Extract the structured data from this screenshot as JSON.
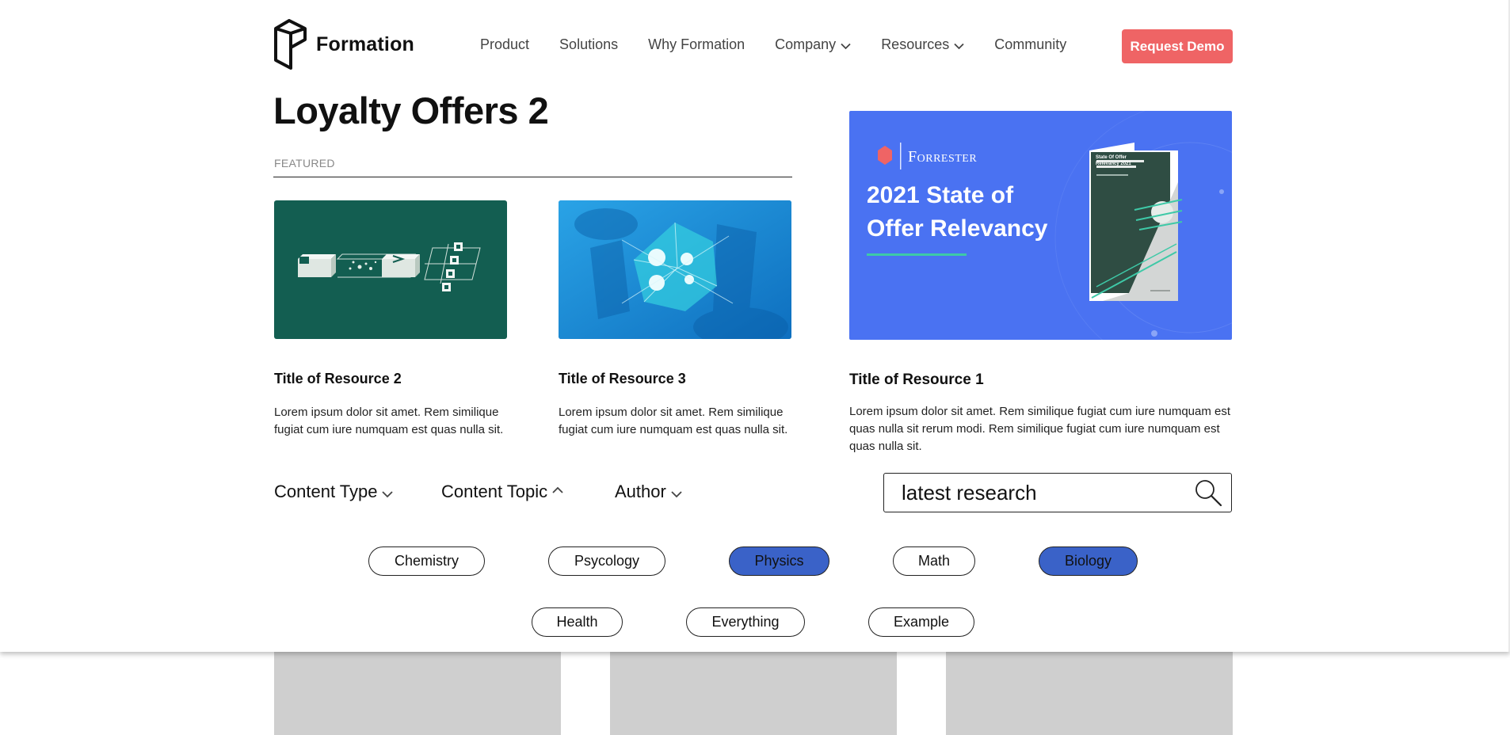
{
  "header": {
    "logo_text": "Formation",
    "nav": [
      {
        "label": "Product",
        "has_dropdown": false
      },
      {
        "label": "Solutions",
        "has_dropdown": false
      },
      {
        "label": "Why Formation",
        "has_dropdown": false
      },
      {
        "label": "Company",
        "has_dropdown": true
      },
      {
        "label": "Resources",
        "has_dropdown": true
      },
      {
        "label": "Community",
        "has_dropdown": false
      }
    ],
    "cta_label": "Request Demo",
    "cta_color": "#ef6465"
  },
  "page": {
    "title": "Loyalty Offers 2",
    "featured_label": "FEATURED"
  },
  "resources": [
    {
      "title": "Title of Resource 2",
      "description": "Lorem ipsum dolor sit amet. Rem similique fugiat cum iure numquam est quas nulla sit.",
      "thumb_color": "#135e51"
    },
    {
      "title": "Title of Resource 3",
      "description": "Lorem ipsum dolor sit amet. Rem similique fugiat cum iure numquam est quas nulla sit.",
      "thumb_color": "#1a8fd6"
    },
    {
      "title": "Title of Resource 1",
      "description": "Lorem ipsum dolor sit amet. Rem similique fugiat cum iure numquam est quas nulla sit rerum modi. Rem similique fugiat cum iure numquam est quas nulla sit.",
      "thumb_color": "#4a72f2",
      "thumb": {
        "brand": "Forrester",
        "headline_line1": "2021 State of",
        "headline_line2": "Offer Relevancy",
        "report_title": "State Of Offer Relevancy 2021"
      }
    }
  ],
  "filters": {
    "content_type": "Content Type",
    "content_topic": "Content Topic",
    "author": "Author",
    "expanded": "content_topic"
  },
  "search": {
    "value": "latest research"
  },
  "topics": [
    {
      "label": "Chemistry",
      "selected": false
    },
    {
      "label": "Psycology",
      "selected": false
    },
    {
      "label": "Physics",
      "selected": true
    },
    {
      "label": "Math",
      "selected": false
    },
    {
      "label": "Biology",
      "selected": true
    },
    {
      "label": "Health",
      "selected": false
    },
    {
      "label": "Everything",
      "selected": false
    },
    {
      "label": "Example",
      "selected": false
    }
  ],
  "colors": {
    "chip_selected": "#3a62c8",
    "placeholder": "#cfcfcf"
  }
}
